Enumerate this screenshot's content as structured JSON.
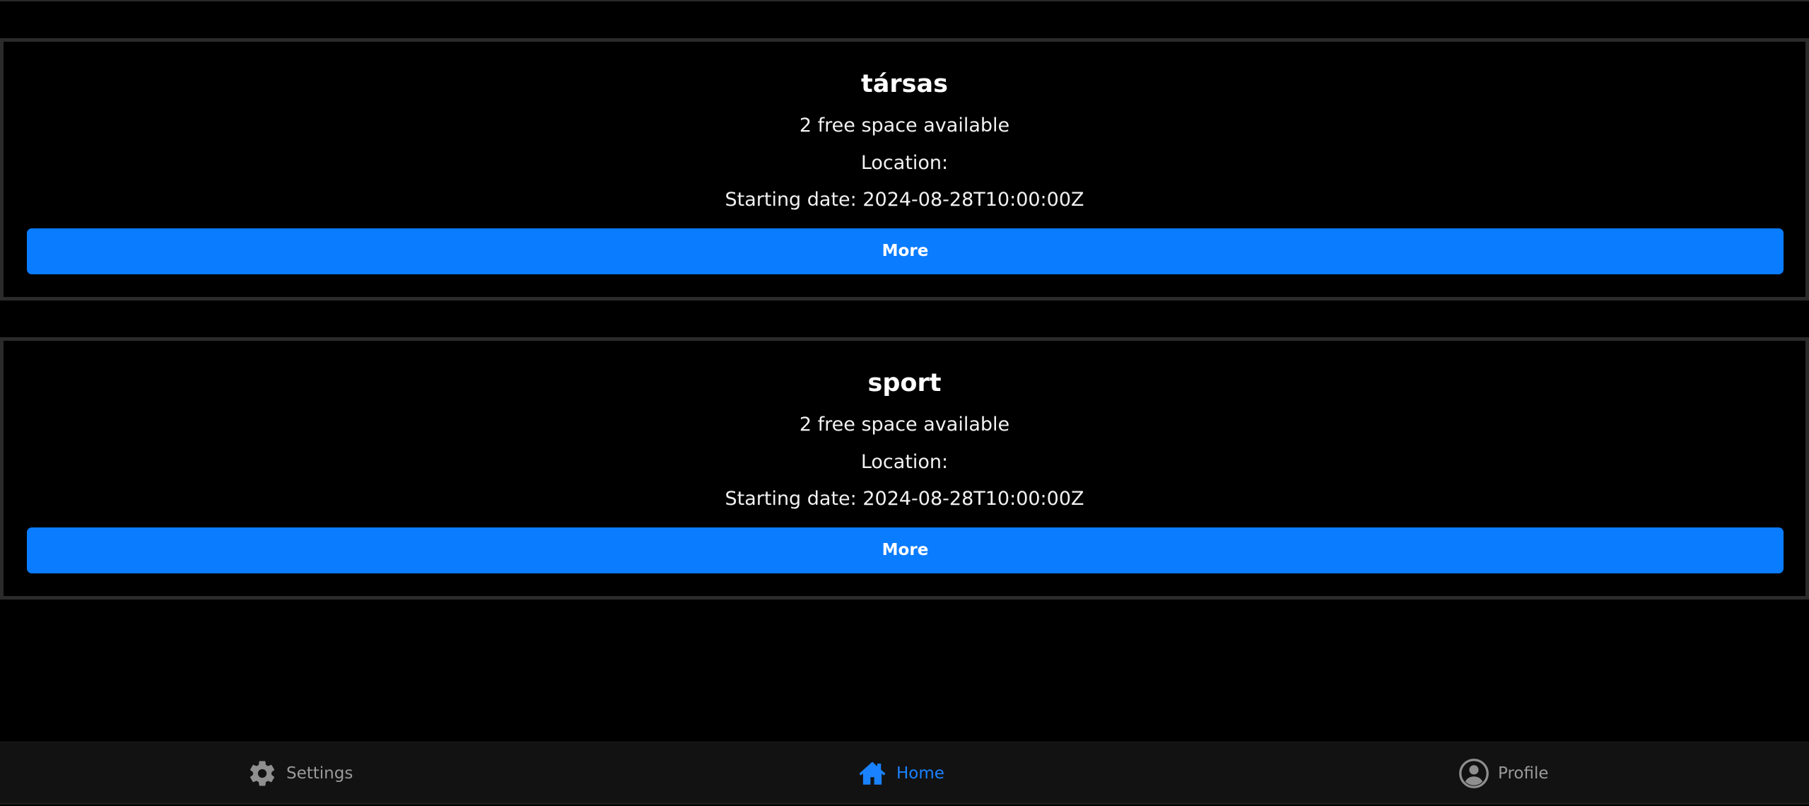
{
  "events": [
    {
      "title": "társas",
      "free_space": "2 free space available",
      "location": "Location:",
      "starting_date": "Starting date: 2024-08-28T10:00:00Z",
      "button_label": "More"
    },
    {
      "title": "sport",
      "free_space": "2 free space available",
      "location": "Location:",
      "starting_date": "Starting date: 2024-08-28T10:00:00Z",
      "button_label": "More"
    }
  ],
  "bottom_nav": {
    "items": [
      {
        "label": "Settings",
        "icon": "gear-icon",
        "active": false
      },
      {
        "label": "Home",
        "icon": "home-icon",
        "active": true
      },
      {
        "label": "Profile",
        "icon": "user-circle-icon",
        "active": false
      }
    ]
  },
  "colors": {
    "background": "#000000",
    "accent": "#0a7cff",
    "nav_background": "#121212",
    "nav_inactive": "#9a9a9a",
    "card_border": "#2b2b2b"
  }
}
